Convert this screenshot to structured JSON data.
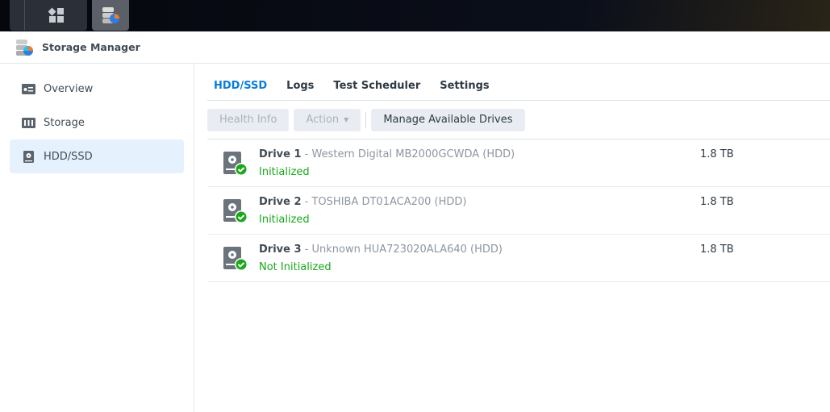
{
  "app": {
    "title": "Storage Manager"
  },
  "sidebar": {
    "items": [
      {
        "label": "Overview",
        "icon": "overview-icon"
      },
      {
        "label": "Storage",
        "icon": "storage-icon"
      },
      {
        "label": "HDD/SSD",
        "icon": "hdd-icon",
        "active": true
      }
    ]
  },
  "tabs": [
    {
      "label": "HDD/SSD",
      "active": true
    },
    {
      "label": "Logs"
    },
    {
      "label": "Test Scheduler"
    },
    {
      "label": "Settings"
    }
  ],
  "toolbar": {
    "health_info": "Health Info",
    "action": "Action",
    "manage": "Manage Available Drives"
  },
  "drives": [
    {
      "name": "Drive 1",
      "model": " - Western Digital MB2000GCWDA (HDD)",
      "status": "Initialized",
      "size": "1.8 TB"
    },
    {
      "name": "Drive 2",
      "model": " - TOSHIBA DT01ACA200 (HDD)",
      "status": "Initialized",
      "size": "1.8 TB"
    },
    {
      "name": "Drive 3",
      "model": " - Unknown HUA723020ALA640 (HDD)",
      "status": "Not Initialized",
      "size": "1.8 TB"
    }
  ],
  "colors": {
    "accent": "#0b7dd8",
    "status_ok": "#1aa81a",
    "active_bg": "#e5f1fd"
  }
}
